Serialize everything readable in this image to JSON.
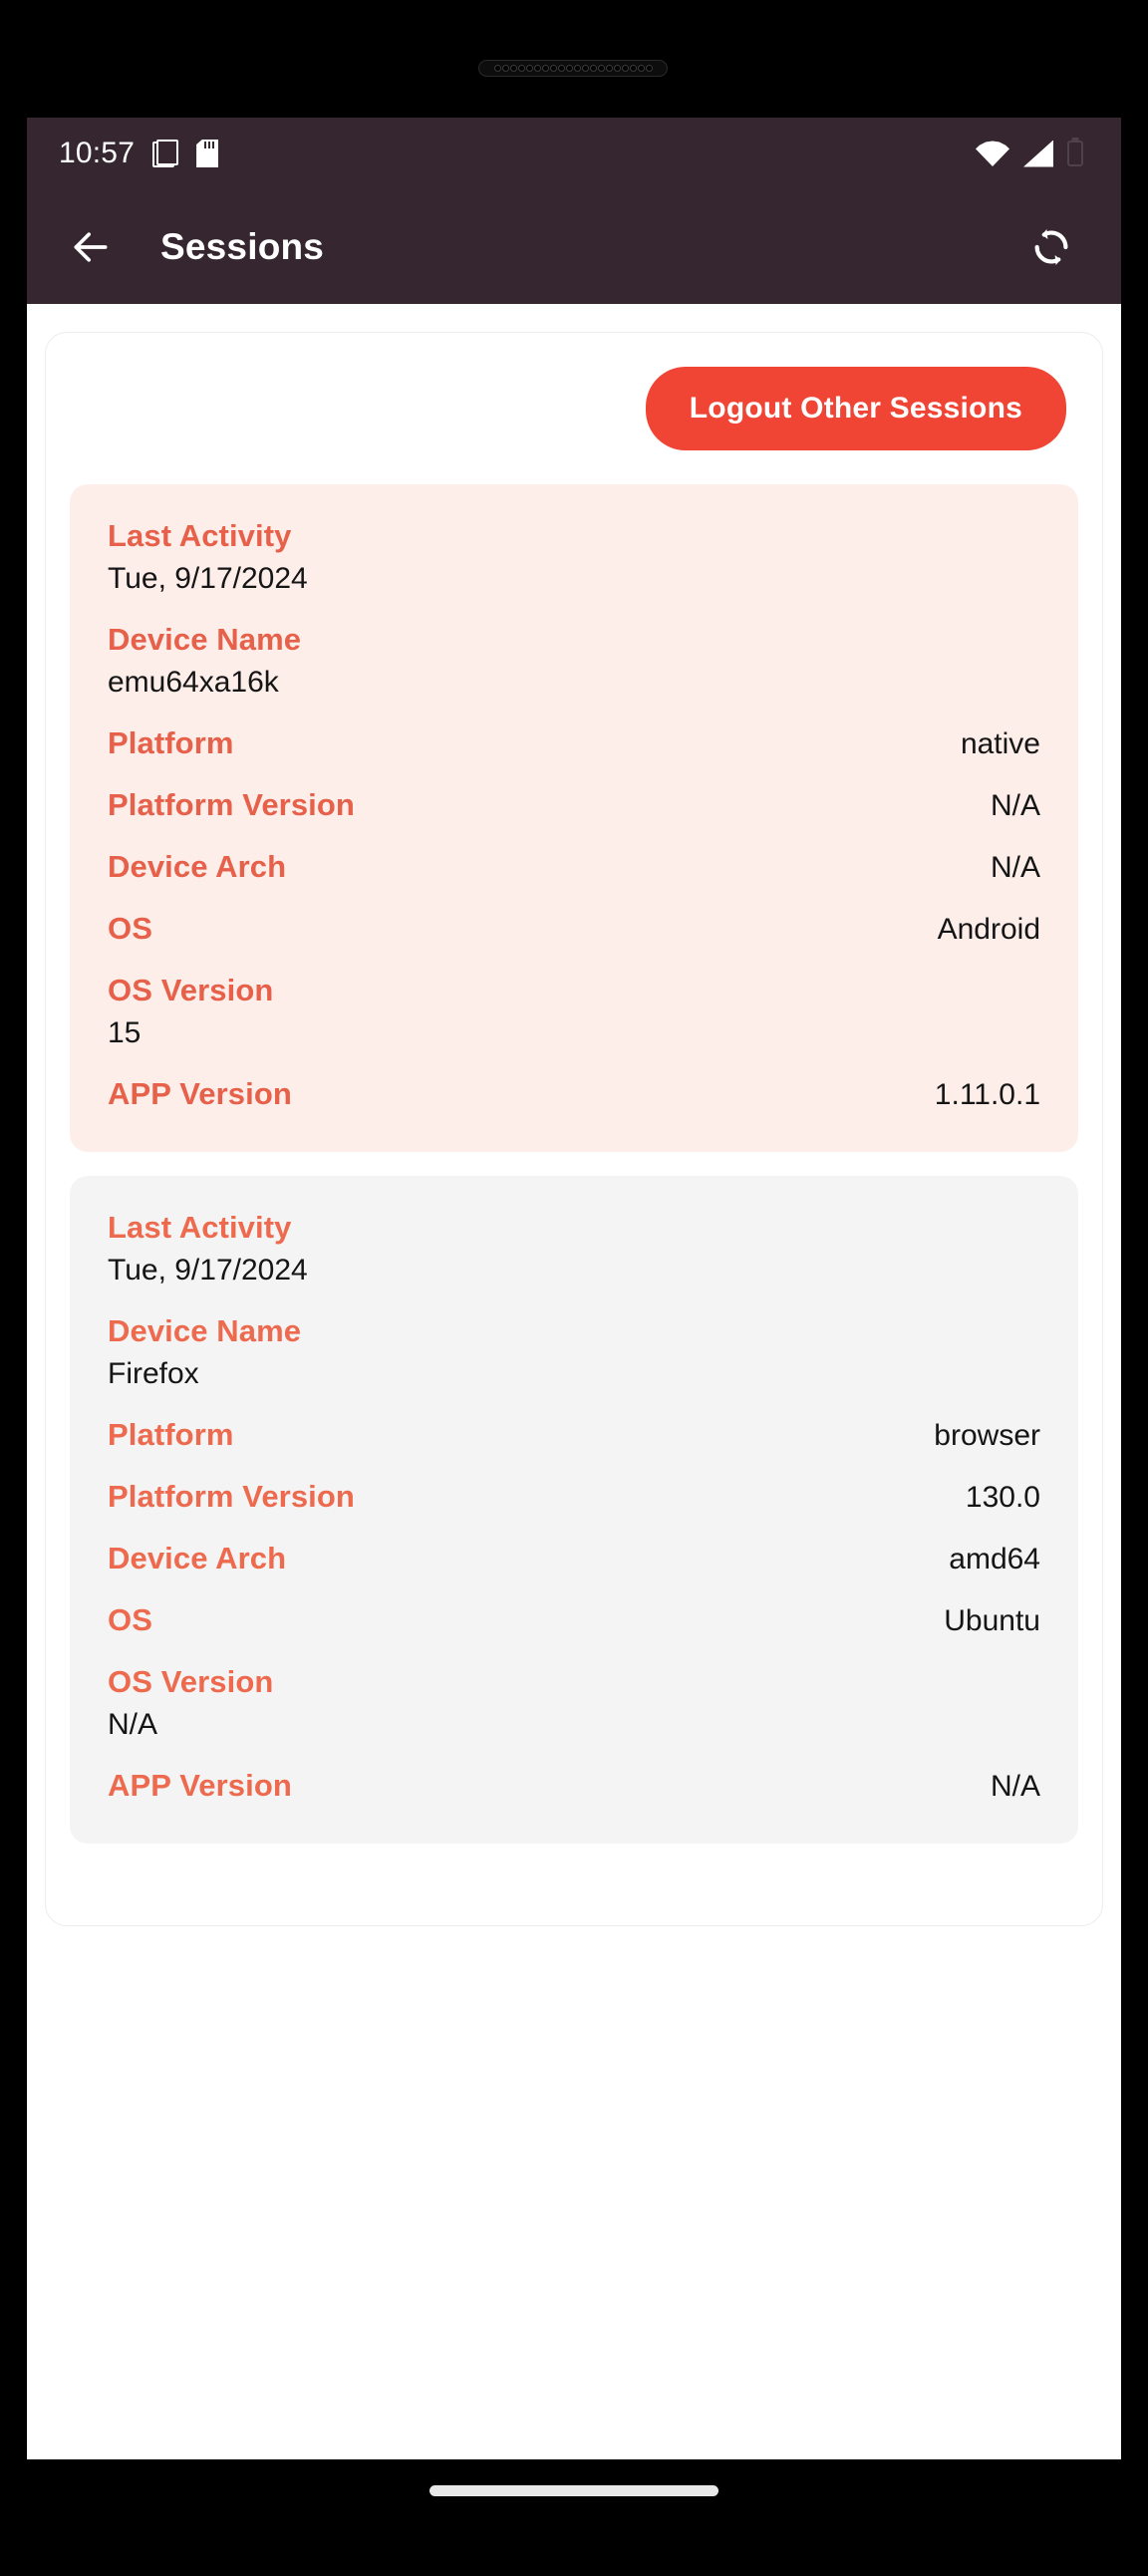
{
  "status_bar": {
    "time": "10:57",
    "icons_left": [
      "copy-icon",
      "sdcard-icon"
    ],
    "icons_right": [
      "wifi-icon",
      "cell-signal-icon",
      "battery-icon"
    ],
    "background_color": "#35262f"
  },
  "app_bar": {
    "back_icon": "arrow-left-icon",
    "title": "Sessions",
    "refresh_icon": "sync-refresh-icon"
  },
  "actions": {
    "logout_other_sessions_label": "Logout Other Sessions",
    "logout_button_color": "#f04434"
  },
  "labels": {
    "last_activity": "Last Activity",
    "device_name": "Device Name",
    "platform": "Platform",
    "platform_version": "Platform Version",
    "device_arch": "Device Arch",
    "os": "OS",
    "os_version": "OS Version",
    "app_version": "APP Version"
  },
  "sessions": [
    {
      "highlight": "current",
      "background_color": "#fdeeea",
      "last_activity": "Tue, 9/17/2024",
      "device_name": "emu64xa16k",
      "platform": "native",
      "platform_version": "N/A",
      "device_arch": "N/A",
      "os": "Android",
      "os_version": "15",
      "app_version": "1.11.0.1"
    },
    {
      "highlight": "other",
      "background_color": "#f4f4f4",
      "last_activity": "Tue, 9/17/2024",
      "device_name": "Firefox",
      "platform": "browser",
      "platform_version": "130.0",
      "device_arch": "amd64",
      "os": "Ubuntu",
      "os_version": "N/A",
      "app_version": "N/A"
    }
  ],
  "navigation": {
    "gesture_pill": "home-gesture-pill"
  },
  "theme": {
    "accent": "#e6604a",
    "appbar": "#35262f",
    "danger": "#f04434"
  }
}
